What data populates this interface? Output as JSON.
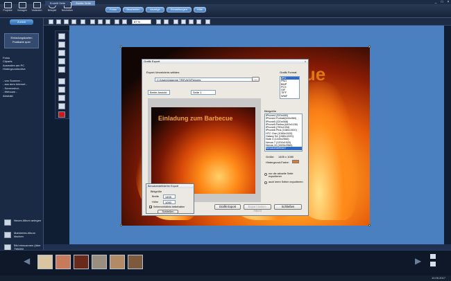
{
  "toolbar": {
    "projects": "Projekte",
    "templates": "Vorlagen",
    "variants": "Varianten",
    "example": "Beispiel",
    "news": "Neuheiten",
    "pills": [
      "Fotos",
      "Bearbeiten",
      "Anzeige",
      "Einstellungen",
      "Hilfe"
    ],
    "zoom": "87 %"
  },
  "left": {
    "back": "Zurück",
    "subtitle_lines": [
      "Einladungskarten",
      "Postkarte quer"
    ],
    "categories": [
      "Fotos",
      "Cliparts",
      "Ausmalen am PC",
      "Hintergrundmotive"
    ],
    "sources": [
      "- von Scanner -",
      "- aus dem Internet -",
      "- Screenshot -",
      "- Webcam -",
      "Abstrakt"
    ],
    "albums": [
      {
        "title": "Neues Album anlegen"
      },
      {
        "title": "Markiertes Album löschen"
      },
      {
        "title": "Bild einscannen (über TWAIN)"
      }
    ]
  },
  "flyer": {
    "title_visible": "ecue"
  },
  "dialog": {
    "title": "Grafik Export",
    "target_label": "Export-Verzeichnis wählen:",
    "path": "C:\\Users\\hdaeme TREVAS\\Pictures",
    "path_button": "...",
    "view_select": "Breite Ansicht",
    "page_select": "Seite 1",
    "format_label": "Grafik Format",
    "formats": [
      "JPG",
      "PNG",
      "BMP",
      "PCX",
      "GIF",
      "TIFF",
      "WMF"
    ],
    "size_label": "Bildgröße",
    "sizes": [
      "iPhone4 (320x480)",
      "iPhone4 Portrait(640x960)",
      "iPhone5 (320x568)",
      "iPhone5 Retina (640x1136)",
      "iPhone6 (750x1334)",
      "iPhone6 Plus (1080x1920)",
      "HTC One (1080x1920)",
      "Galaxy S4 (1080x1920)",
      "Note 4 (1440x2560)",
      "Nexus 7 (1200x1920)",
      "Nexus 10 (1600x2560)",
      "Benutzerdefiniert"
    ],
    "size_readout_label": "Größe:",
    "size_readout": "1405 x 1050",
    "bg_label": "Hintergrund-Farbe:",
    "radio1": "nur die aktuelle Seite exportieren",
    "radio2": "auch leere Seiten exportieren",
    "export_button": "Grafik Export",
    "multi_button": "Export Seiten-Album",
    "close_button": "Schließen",
    "preview_title": "Einladung zum Barbecue"
  },
  "subdialog": {
    "title": "Benutzerdefinierter Export",
    "size_label": "Bildgröße",
    "width_label": "Breite",
    "width_value": "1405",
    "height_label": "Höhe",
    "height_value": "1050",
    "keep_ratio": "Seitenverhältnis beibehalten",
    "close_button": "Schließen"
  },
  "tabs": [
    "Erstellt Seite",
    "Zweite Seite"
  ],
  "taskbar": {
    "date": "10.05.2017"
  },
  "colors": {
    "accent": "#3f78bb",
    "selection": "#3169c6",
    "canvas": "#4a7fc0"
  }
}
